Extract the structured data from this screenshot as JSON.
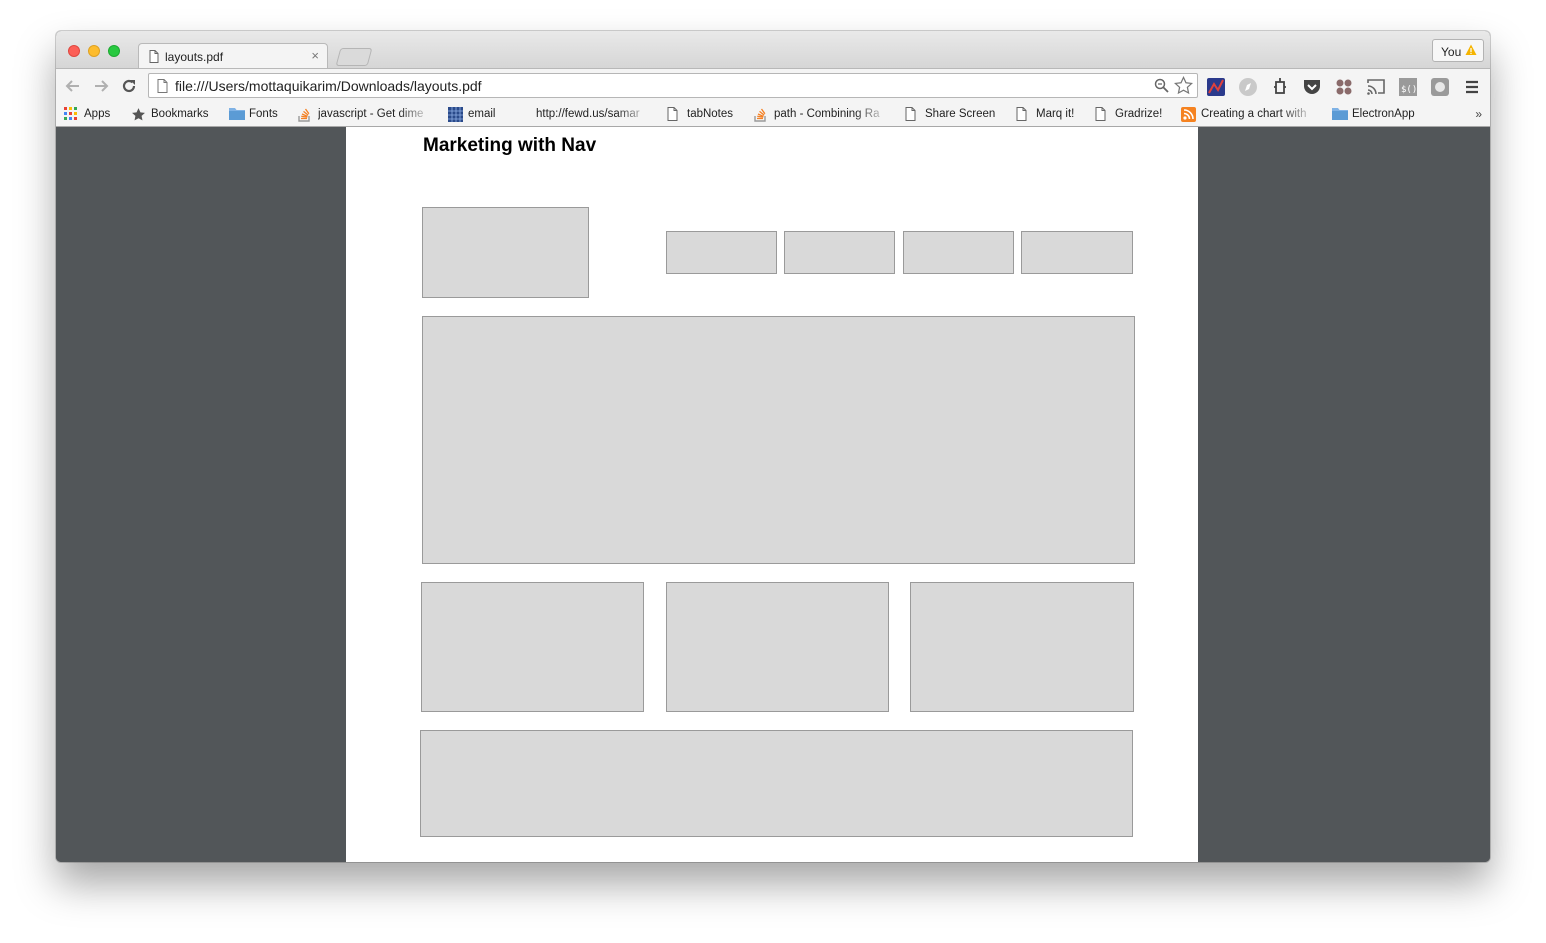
{
  "browser": {
    "tab": {
      "title": "layouts.pdf",
      "close": "×"
    },
    "profile": {
      "name": "You"
    },
    "address": {
      "url": "file:///Users/mottaquikarim/Downloads/layouts.pdf"
    },
    "bookmarks": [
      {
        "label": "Apps",
        "icon": "apps-grid-icon"
      },
      {
        "label": "Bookmarks",
        "icon": "star-icon"
      },
      {
        "label": "Fonts",
        "icon": "folder-icon"
      },
      {
        "label": "javascript - Get dime",
        "icon": "stackoverflow-icon"
      },
      {
        "label": "email",
        "icon": "grid-calendar-icon"
      },
      {
        "label": "http://fewd.us/samar",
        "icon": "none"
      },
      {
        "label": "tabNotes",
        "icon": "page-icon"
      },
      {
        "label": "path - Combining Ra",
        "icon": "stackoverflow-icon"
      },
      {
        "label": "Share Screen",
        "icon": "page-icon"
      },
      {
        "label": "Marq it!",
        "icon": "page-icon"
      },
      {
        "label": "Gradrize!",
        "icon": "page-icon"
      },
      {
        "label": "Creating a chart with",
        "icon": "rss-icon"
      },
      {
        "label": "ElectronApp",
        "icon": "folder-icon"
      }
    ],
    "bookmarks_more": "»"
  },
  "document": {
    "title": "Marketing with Nav"
  },
  "colors": {
    "viewer_background": "#525659",
    "placeholder_fill": "#d9d9d9",
    "placeholder_border": "#9a9a9a"
  }
}
